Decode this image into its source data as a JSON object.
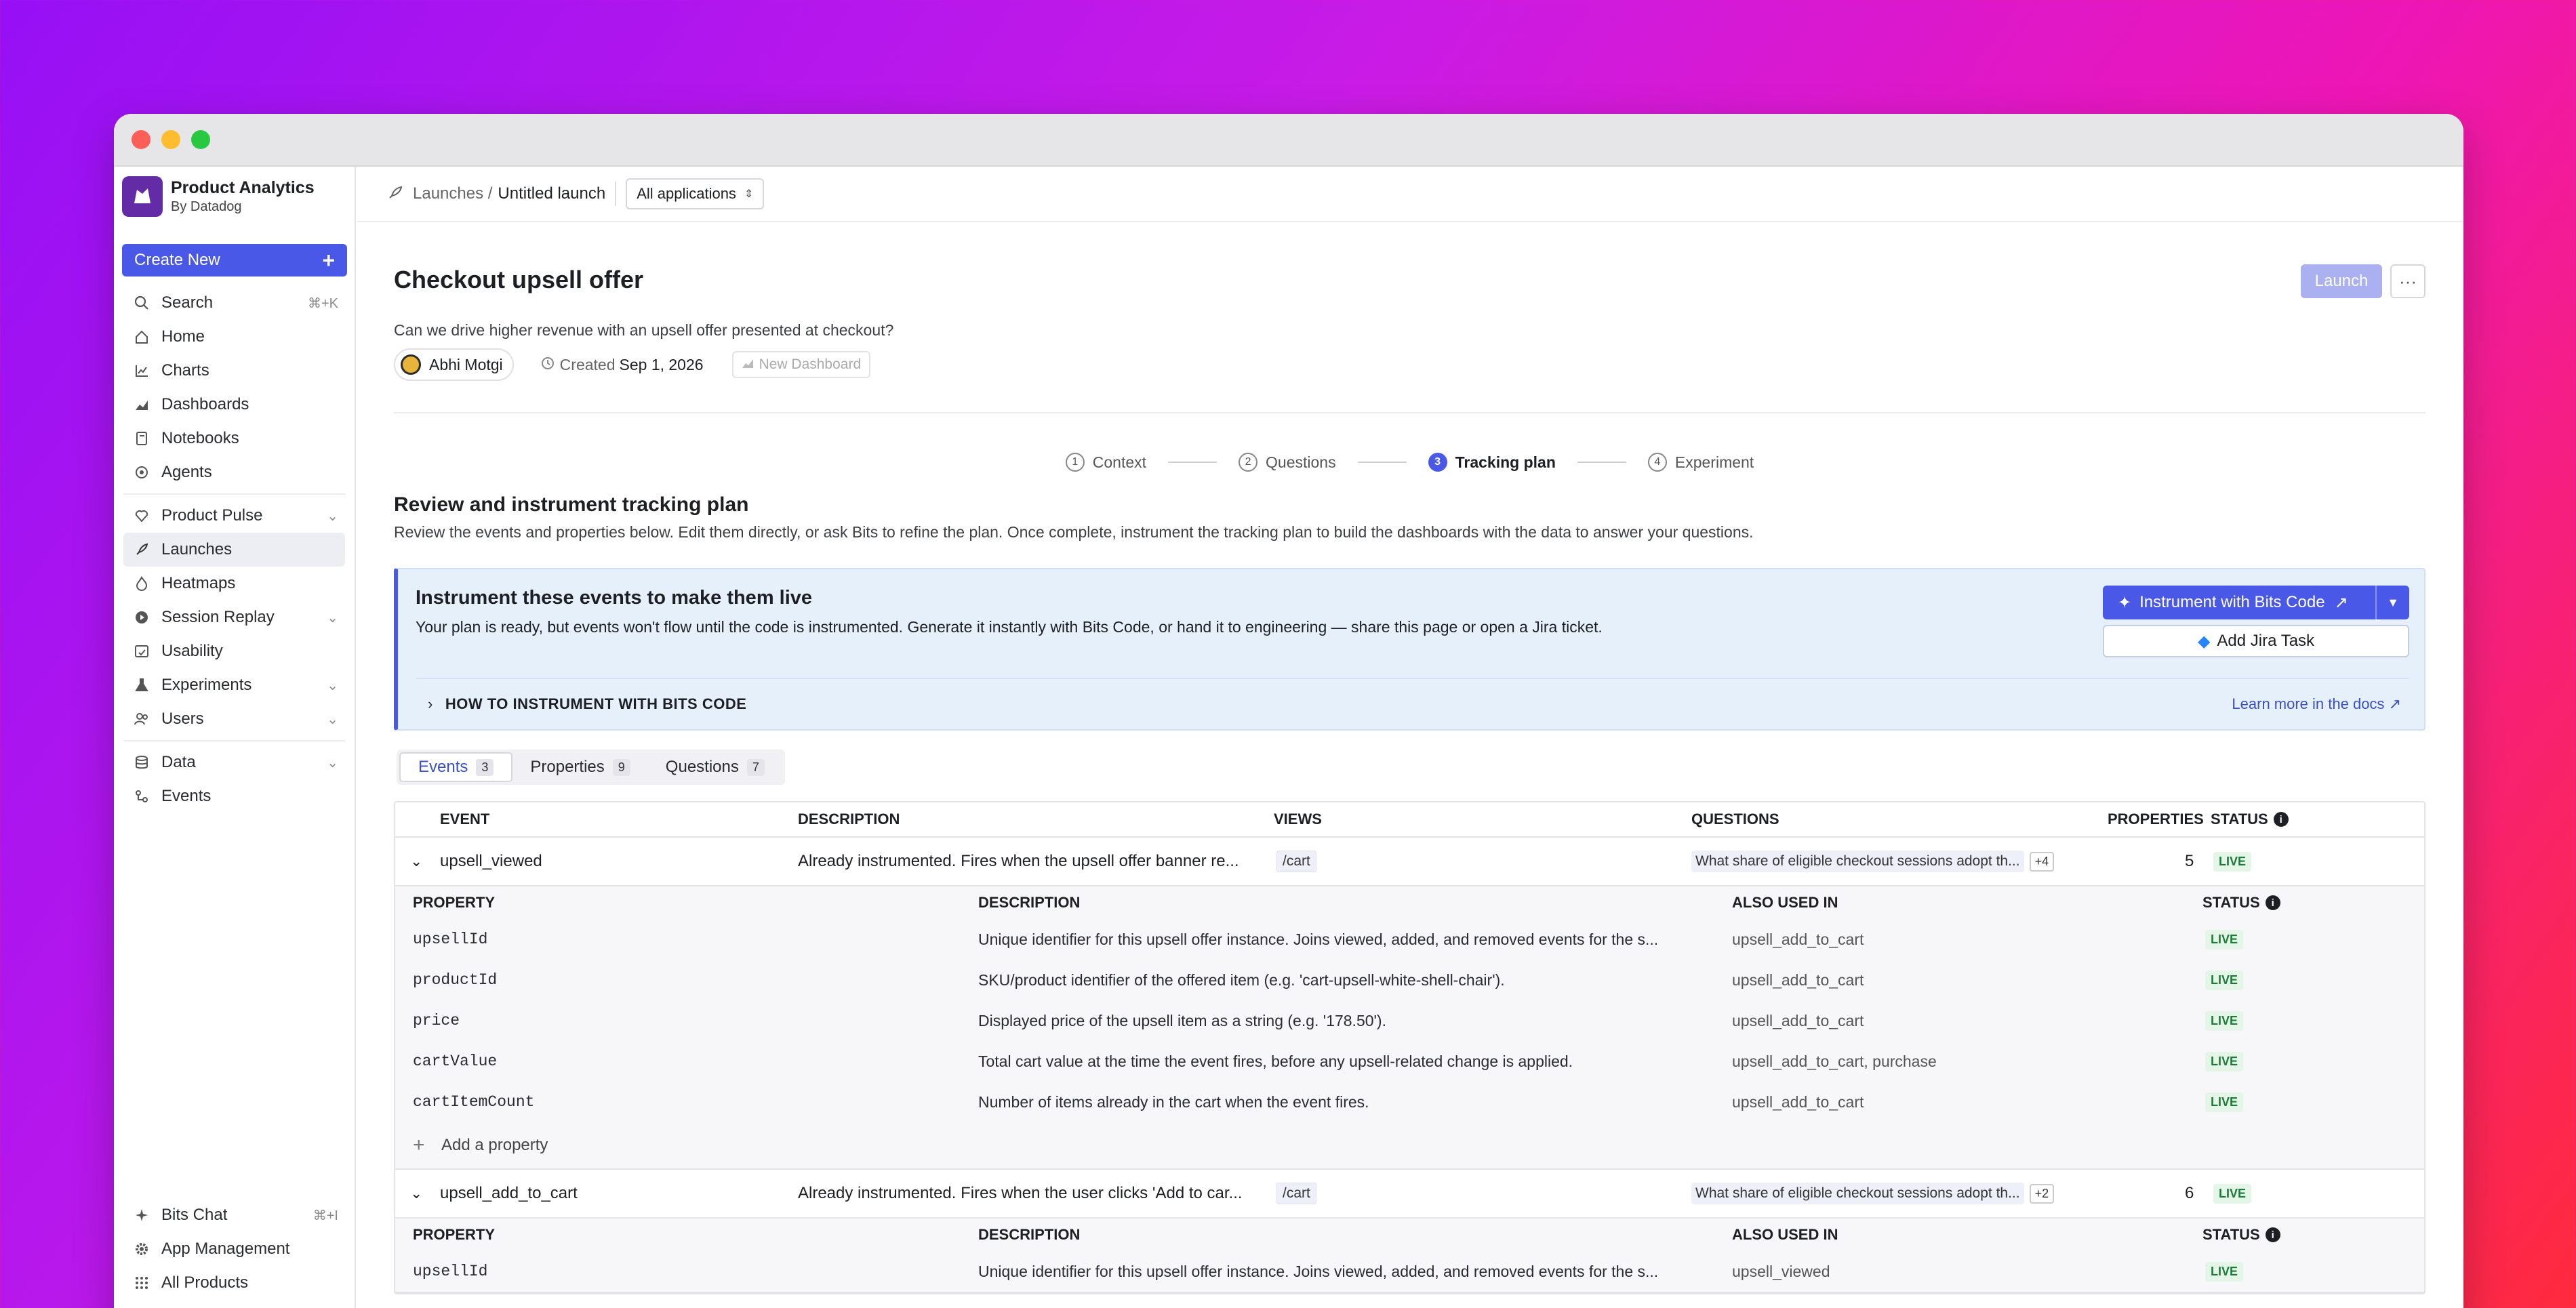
{
  "window": {
    "title": ""
  },
  "brand": {
    "title": "Product Analytics",
    "subtitle": "By Datadog"
  },
  "sidebar": {
    "create_label": "Create New",
    "items": [
      {
        "label": "Search",
        "shortcut": "⌘+K",
        "icon": "search-icon"
      },
      {
        "label": "Home",
        "icon": "home-icon"
      },
      {
        "label": "Charts",
        "icon": "chart-icon"
      },
      {
        "label": "Dashboards",
        "icon": "dashboard-icon"
      },
      {
        "label": "Notebooks",
        "icon": "notebook-icon"
      },
      {
        "label": "Agents",
        "icon": "agent-icon"
      },
      {
        "label": "Product Pulse",
        "icon": "pulse-icon"
      },
      {
        "label": "Launches",
        "icon": "rocket-icon"
      },
      {
        "label": "Heatmaps",
        "icon": "flame-icon"
      },
      {
        "label": "Session Replay",
        "icon": "play-icon"
      },
      {
        "label": "Usability",
        "icon": "usability-icon"
      },
      {
        "label": "Experiments",
        "icon": "flask-icon"
      },
      {
        "label": "Users",
        "icon": "users-icon"
      },
      {
        "label": "Data",
        "icon": "database-icon"
      },
      {
        "label": "Events",
        "icon": "events-icon"
      }
    ],
    "bottom": [
      {
        "label": "Bits Chat",
        "shortcut": "⌘+I",
        "icon": "sparkle-icon"
      },
      {
        "label": "App Management",
        "icon": "gear-icon"
      },
      {
        "label": "All Products",
        "icon": "grid-icon"
      }
    ]
  },
  "topbar": {
    "crumb_root": "Launches /",
    "crumb_current": "Untitled launch",
    "app_select": "All applications"
  },
  "page": {
    "title": "Checkout upsell offer",
    "subtitle": "Can we drive higher revenue with an upsell offer presented at checkout?",
    "owner": "Abhi Motgi",
    "created_label": "Created",
    "created_date": "Sep 1, 2026",
    "new_dashboard": "New Dashboard",
    "launch_label": "Launch",
    "more_label": "···"
  },
  "steps": [
    {
      "num": "1",
      "label": "Context"
    },
    {
      "num": "2",
      "label": "Questions"
    },
    {
      "num": "3",
      "label": "Tracking plan"
    },
    {
      "num": "4",
      "label": "Experiment"
    }
  ],
  "section": {
    "title": "Review and instrument tracking plan",
    "subtitle": "Review the events and properties below. Edit them directly, or ask Bits to refine the plan. Once complete, instrument the tracking plan to build the dashboards with the data to answer your questions."
  },
  "banner": {
    "title": "Instrument these events to make them live",
    "text": "Your plan is ready, but events won't flow until the code is instrumented. Generate it instantly with Bits Code, or hand it to engineering — share this page or open a Jira ticket.",
    "bits_label": "Instrument with Bits Code",
    "jira_label": "Add Jira Task",
    "howto": "HOW TO INSTRUMENT WITH BITS CODE",
    "learn": "Learn more in the docs"
  },
  "tabs": [
    {
      "label": "Events",
      "count": "3"
    },
    {
      "label": "Properties",
      "count": "9"
    },
    {
      "label": "Questions",
      "count": "7"
    }
  ],
  "table": {
    "headers": {
      "event": "EVENT",
      "description": "DESCRIPTION",
      "views": "VIEWS",
      "questions": "QUESTIONS",
      "properties": "PROPERTIES",
      "status": "STATUS"
    },
    "prop_headers": {
      "property": "PROPERTY",
      "description": "DESCRIPTION",
      "also": "ALSO USED IN",
      "status": "STATUS"
    },
    "add_property": "Add a property",
    "events": [
      {
        "name": "upsell_viewed",
        "description": "Already instrumented. Fires when the upsell offer banner re...",
        "view": "/cart",
        "question": "What share of eligible checkout sessions adopt th...",
        "more": "+4",
        "properties": "5",
        "status": "LIVE",
        "props": [
          {
            "name": "upsellId",
            "description": "Unique identifier for this upsell offer instance. Joins viewed, added, and removed events for the s...",
            "also": "upsell_add_to_cart",
            "status": "LIVE"
          },
          {
            "name": "productId",
            "description": "SKU/product identifier of the offered item (e.g. 'cart-upsell-white-shell-chair').",
            "also": "upsell_add_to_cart",
            "status": "LIVE"
          },
          {
            "name": "price",
            "description": "Displayed price of the upsell item as a string (e.g. '178.50').",
            "also": "upsell_add_to_cart",
            "status": "LIVE"
          },
          {
            "name": "cartValue",
            "description": "Total cart value at the time the event fires, before any upsell-related change is applied.",
            "also": "upsell_add_to_cart, purchase",
            "status": "LIVE"
          },
          {
            "name": "cartItemCount",
            "description": "Number of items already in the cart when the event fires.",
            "also": "upsell_add_to_cart",
            "status": "LIVE"
          }
        ]
      },
      {
        "name": "upsell_add_to_cart",
        "description": "Already instrumented. Fires when the user clicks 'Add to car...",
        "view": "/cart",
        "question": "What share of eligible checkout sessions adopt th...",
        "more": "+2",
        "properties": "6",
        "status": "LIVE",
        "props": [
          {
            "name": "upsellId",
            "description": "Unique identifier for this upsell offer instance. Joins viewed, added, and removed events for the s...",
            "also": "upsell_viewed",
            "status": "LIVE"
          }
        ]
      }
    ]
  }
}
